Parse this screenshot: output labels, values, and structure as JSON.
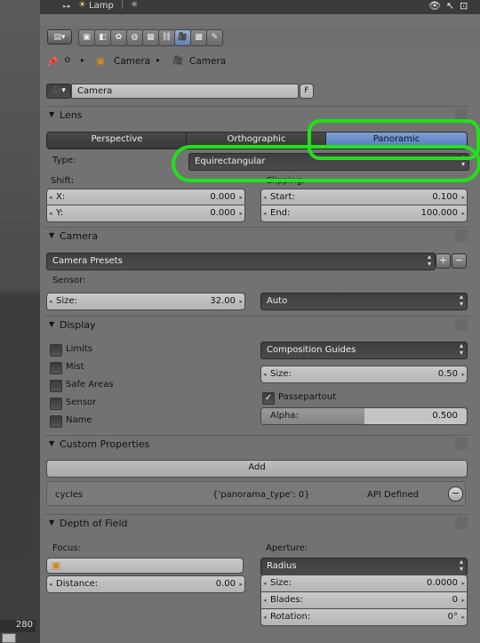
{
  "outliner": {
    "lamp_label": "Lamp",
    "bottom_number": "280"
  },
  "breadcrumb": {
    "item1": "Camera",
    "item2": "Camera"
  },
  "datablock": {
    "name": "Camera",
    "fake_user": "F"
  },
  "lens": {
    "title": "Lens",
    "modes": [
      "Perspective",
      "Orthographic",
      "Panoramic"
    ],
    "active_mode": "Panoramic",
    "type_label": "Type:",
    "type_value": "Equirectangular",
    "shift_label": "Shift:",
    "shift_x_label": "X:",
    "shift_x": "0.000",
    "shift_y_label": "Y:",
    "shift_y": "0.000",
    "clipping_label": "Clipping:",
    "clip_start_label": "Start:",
    "clip_start": "0.100",
    "clip_end_label": "End:",
    "clip_end": "100.000"
  },
  "camera": {
    "title": "Camera",
    "presets": "Camera Presets",
    "sensor_label": "Sensor:",
    "size_label": "Size:",
    "size_value": "32.00",
    "fit": "Auto"
  },
  "display": {
    "title": "Display",
    "checks": [
      {
        "label": "Limits",
        "checked": false
      },
      {
        "label": "Mist",
        "checked": false
      },
      {
        "label": "Safe Areas",
        "checked": false
      },
      {
        "label": "Sensor",
        "checked": false
      },
      {
        "label": "Name",
        "checked": false
      }
    ],
    "guides": "Composition Guides",
    "size_label": "Size:",
    "size_value": "0.50",
    "passepartout_label": "Passepartout",
    "passepartout_checked": true,
    "alpha_label": "Alpha:",
    "alpha_value": "0.500",
    "alpha_fraction": 0.5
  },
  "custom_props": {
    "title": "Custom Properties",
    "add_label": "Add",
    "prop_name": "cycles",
    "prop_value": "{'panorama_type': 0}",
    "prop_source": "API Defined",
    "remove_label": "−"
  },
  "dof": {
    "title": "Depth of Field",
    "focus_label": "Focus:",
    "distance_label": "Distance:",
    "distance_value": "0.00",
    "aperture_label": "Aperture:",
    "aperture_type": "Radius",
    "ap_size_label": "Size:",
    "ap_size_value": "0.0000",
    "blades_label": "Blades:",
    "blades_value": "0",
    "rotation_label": "Rotation:",
    "rotation_value": "0°"
  },
  "colors": {
    "accent": "#5d86c9",
    "annotation": "#22e01a"
  }
}
